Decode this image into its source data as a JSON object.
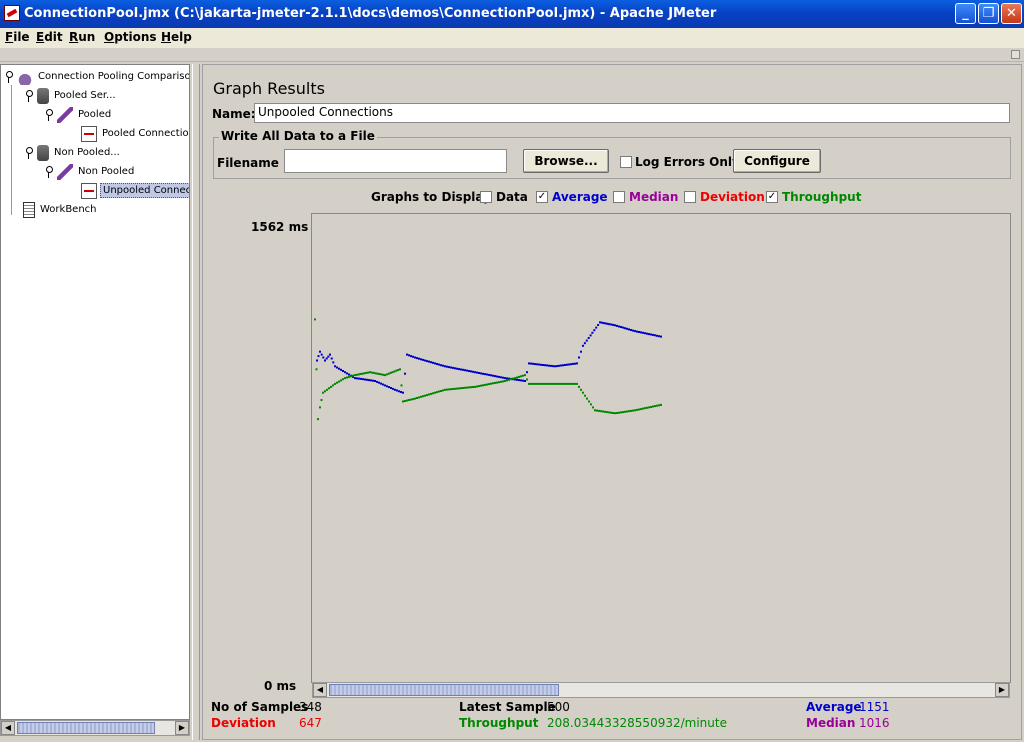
{
  "window": {
    "title": "ConnectionPool.jmx (C:\\jakarta-jmeter-2.1.1\\docs\\demos\\ConnectionPool.jmx) - Apache JMeter"
  },
  "menu": [
    "File",
    "Edit",
    "Run",
    "Options",
    "Help"
  ],
  "tree": {
    "root": "Connection Pooling Compariso",
    "pooled_server": "Pooled Ser...",
    "pooled": "Pooled",
    "pooled_connections": "Pooled Connection",
    "non_pooled_server": "Non Pooled...",
    "non_pooled": "Non Pooled",
    "unpooled_connections": "Unpooled Connec",
    "workbench": "WorkBench"
  },
  "panel": {
    "title": "Graph Results",
    "name_label": "Name:",
    "name_value": "Unpooled Connections",
    "file_group": "Write All Data to a File",
    "filename_label": "Filename",
    "filename_value": "",
    "browse_button": "Browse...",
    "log_errors_label": "Log Errors Only",
    "configure_button": "Configure",
    "graphs_to_display": "Graphs to Display",
    "options": [
      {
        "label": "Data",
        "checked": false,
        "color": "#000000"
      },
      {
        "label": "Average",
        "checked": true,
        "color": "#0000cc"
      },
      {
        "label": "Median",
        "checked": false,
        "color": "#990099"
      },
      {
        "label": "Deviation",
        "checked": false,
        "color": "#ee0000"
      },
      {
        "label": "Throughput",
        "checked": true,
        "color": "#008800"
      }
    ]
  },
  "chart_data": {
    "type": "scatter",
    "y_top_label": "1562",
    "y_bottom_label": "0",
    "y_unit": "ms",
    "ylim": [
      0,
      1562
    ],
    "xlim": [
      0,
      348
    ],
    "series": [
      {
        "name": "Average",
        "color": "#0000cc",
        "points": [
          [
            2,
            1100
          ],
          [
            5,
            1130
          ],
          [
            10,
            1100
          ],
          [
            15,
            1120
          ],
          [
            20,
            1080
          ],
          [
            30,
            1060
          ],
          [
            40,
            1040
          ],
          [
            60,
            1030
          ],
          [
            80,
            1000
          ],
          [
            88,
            990
          ],
          [
            92,
            1120
          ],
          [
            100,
            1110
          ],
          [
            130,
            1080
          ],
          [
            160,
            1060
          ],
          [
            190,
            1040
          ],
          [
            210,
            1030
          ],
          [
            214,
            1090
          ],
          [
            240,
            1080
          ],
          [
            262,
            1090
          ],
          [
            268,
            1150
          ],
          [
            285,
            1230
          ],
          [
            300,
            1220
          ],
          [
            320,
            1200
          ],
          [
            348,
            1180
          ]
        ]
      },
      {
        "name": "Throughput",
        "color": "#008800",
        "points": [
          [
            0,
            1240
          ],
          [
            3,
            900
          ],
          [
            5,
            940
          ],
          [
            8,
            990
          ],
          [
            12,
            1000
          ],
          [
            20,
            1020
          ],
          [
            30,
            1040
          ],
          [
            40,
            1050
          ],
          [
            55,
            1060
          ],
          [
            70,
            1050
          ],
          [
            85,
            1070
          ],
          [
            88,
            960
          ],
          [
            100,
            970
          ],
          [
            130,
            1000
          ],
          [
            160,
            1010
          ],
          [
            190,
            1030
          ],
          [
            210,
            1050
          ],
          [
            214,
            1020
          ],
          [
            262,
            1020
          ],
          [
            270,
            980
          ],
          [
            280,
            930
          ],
          [
            300,
            920
          ],
          [
            320,
            930
          ],
          [
            348,
            950
          ]
        ]
      }
    ]
  },
  "stats": {
    "samples_label": "No of Samples",
    "samples_value": "348",
    "latest_label": "Latest Sample",
    "latest_value": "500",
    "average_label": "Average",
    "average_value": "1151",
    "deviation_label": "Deviation",
    "deviation_value": "647",
    "throughput_label": "Throughput",
    "throughput_value": "208.03443328550932/minute",
    "median_label": "Median",
    "median_value": "1016"
  },
  "colors": {
    "average": "#0000cc",
    "median": "#990099",
    "deviation": "#ee0000",
    "throughput": "#008800"
  }
}
